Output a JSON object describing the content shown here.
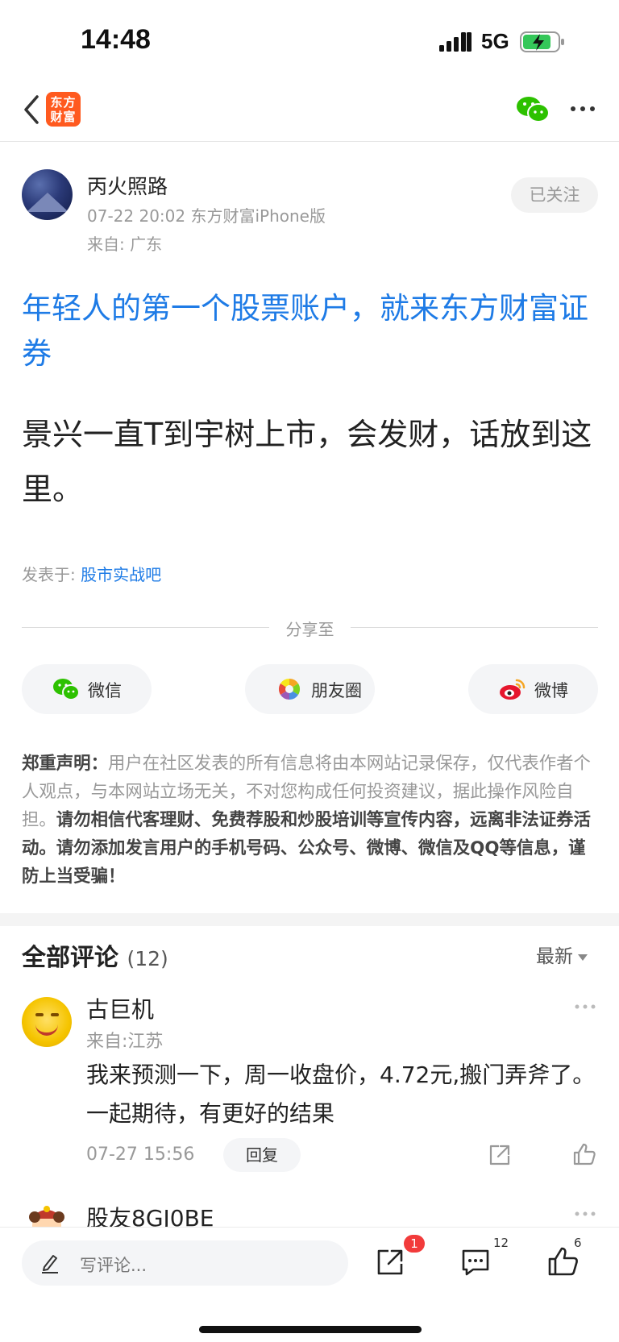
{
  "status_bar": {
    "time": "14:48",
    "network": "5G"
  },
  "nav": {
    "app_logo_text": "东方财富"
  },
  "author": {
    "name": "丙火照路",
    "meta": "07-22 20:02 东方财富iPhone版",
    "location": "来自: 广东",
    "follow_label": "已关注"
  },
  "post": {
    "title": "年轻人的第一个股票账户，就来东方财富证券",
    "body": "景兴一直T到宇树上市，会发财，话放到这里。",
    "posted_in_label": "发表于: ",
    "forum": "股市实战吧"
  },
  "share": {
    "label": "分享至",
    "wechat": "微信",
    "moments": "朋友圈",
    "weibo": "微博"
  },
  "disclaimer": {
    "lead": "郑重声明：",
    "normal": "用户在社区发表的所有信息将由本网站记录保存，仅代表作者个人观点，与本网站立场无关，不对您构成任何投资建议，据此操作风险自担。",
    "bold": "请勿相信代客理财、免费荐股和炒股培训等宣传内容，远离非法证券活动。请勿添加发言用户的手机号码、公众号、微博、微信及QQ等信息，谨防上当受骗！"
  },
  "comments": {
    "title": "全部评论",
    "count": "(12)",
    "sort_label": "最新",
    "items": [
      {
        "name": "古巨机",
        "location": "来自:江苏",
        "text": "我来预测一下，周一收盘价，4.72元,搬门弄斧了。一起期待，有更好的结果",
        "time": "07-27 15:56",
        "reply_label": "回复"
      },
      {
        "name": "股友8GJ0BE"
      }
    ]
  },
  "bottom_bar": {
    "input_placeholder": "写评论...",
    "share_badge": "1",
    "comment_count": "12",
    "like_count": "6"
  },
  "colors": {
    "accent_blue": "#1e7be6",
    "brand_orange": "#ff5a1f",
    "badge_red": "#f23b3b",
    "wechat_green": "#2dc100"
  }
}
